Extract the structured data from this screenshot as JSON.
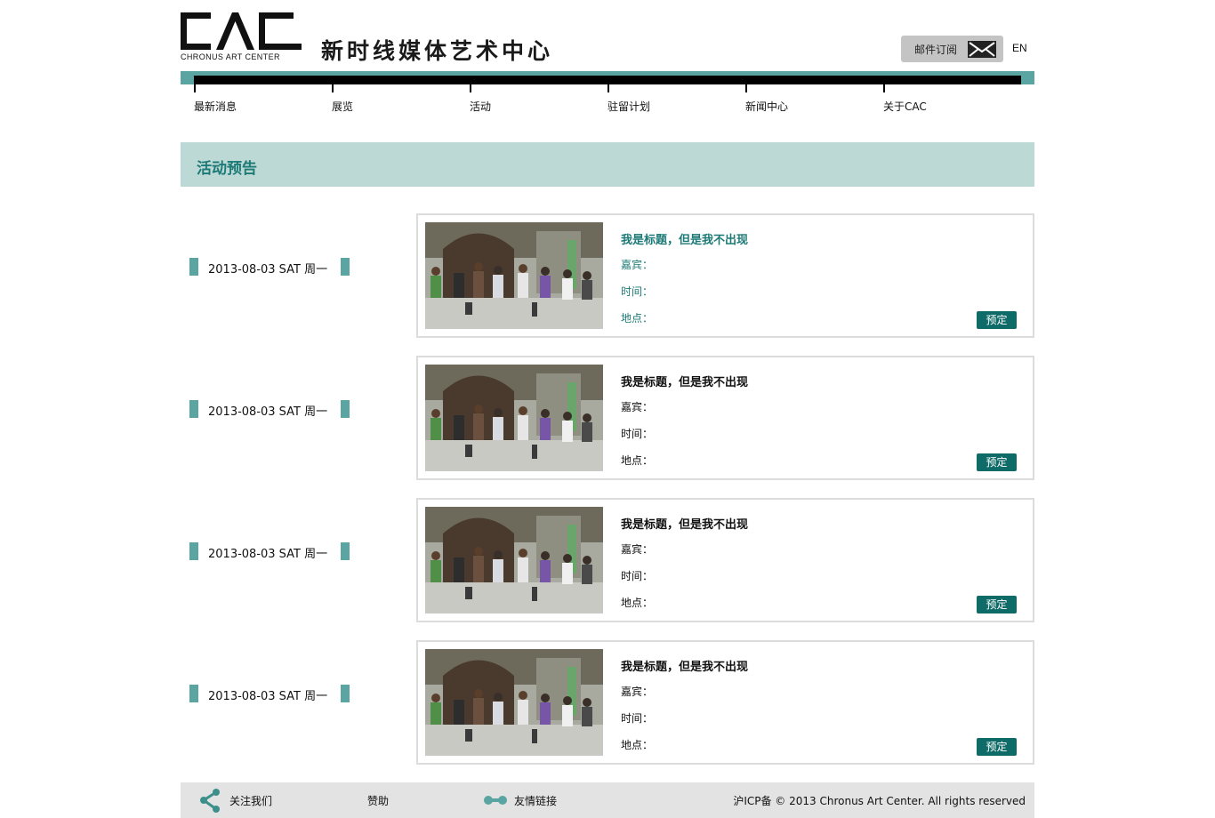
{
  "header": {
    "logo_text": "CAC",
    "logo_subtitle": "CHRONUS ART CENTER",
    "site_name": "新时线媒体艺术中心",
    "subscribe_label": "邮件订阅",
    "lang_label": "EN"
  },
  "nav": {
    "items": [
      {
        "label": "最新消息"
      },
      {
        "label": "展览"
      },
      {
        "label": "活动"
      },
      {
        "label": "驻留计划"
      },
      {
        "label": "新闻中心"
      },
      {
        "label": "关于CAC"
      }
    ]
  },
  "section": {
    "title": "活动预告"
  },
  "events": [
    {
      "date": "2013-08-03 SAT 周一",
      "title": "我是标题，但是我不出现",
      "guest_label": "嘉宾：",
      "time_label": "时间：",
      "place_label": "地点：",
      "button": "预定",
      "highlighted": true
    },
    {
      "date": "2013-08-03 SAT 周一",
      "title": "我是标题，但是我不出现",
      "guest_label": "嘉宾：",
      "time_label": "时间：",
      "place_label": "地点：",
      "button": "预定",
      "highlighted": false
    },
    {
      "date": "2013-08-03 SAT 周一",
      "title": "我是标题，但是我不出现",
      "guest_label": "嘉宾：",
      "time_label": "时间：",
      "place_label": "地点：",
      "button": "预定",
      "highlighted": false
    },
    {
      "date": "2013-08-03 SAT 周一",
      "title": "我是标题，但是我不出现",
      "guest_label": "嘉宾：",
      "time_label": "时间：",
      "place_label": "地点：",
      "button": "预定",
      "highlighted": false
    }
  ],
  "footer": {
    "follow_label": "关注我们",
    "sponsor_label": "赞助",
    "links_label": "友情链接",
    "copyright": "沪ICP备 © 2013 Chronus Art Center. All rights reserved"
  },
  "colors": {
    "accent": "#5aa5a1",
    "accent_dark": "#0f6b68",
    "banner_bg": "#bcd9d6",
    "title_teal": "#1d7a76",
    "footer_bg": "#e3e3e3"
  },
  "icons": {
    "subscribe": "mail-icon",
    "follow": "share-icon",
    "links": "link-icon"
  }
}
